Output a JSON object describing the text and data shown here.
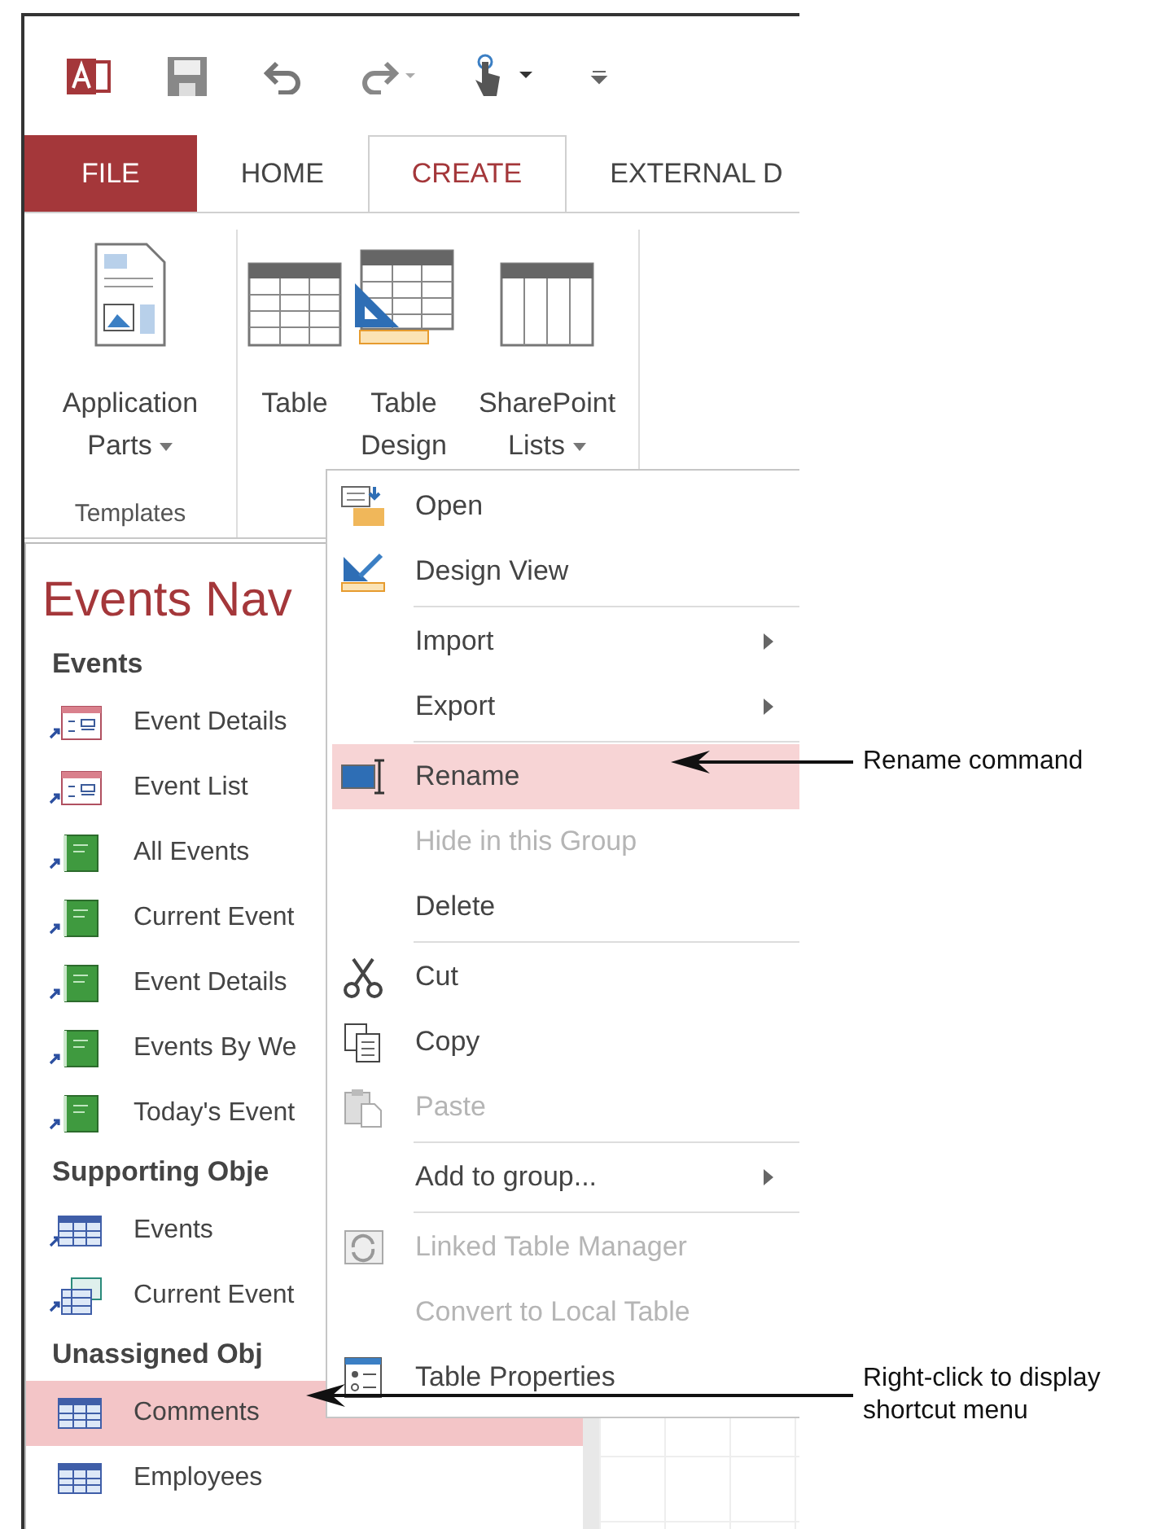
{
  "tabs": [
    {
      "label": "FILE",
      "kind": "file",
      "selected": false
    },
    {
      "label": "HOME",
      "kind": "tab",
      "selected": false
    },
    {
      "label": "CREATE",
      "kind": "tab",
      "selected": true
    },
    {
      "label": "EXTERNAL D",
      "kind": "tab",
      "selected": false
    }
  ],
  "ribbon": {
    "groups": [
      {
        "label": "Templates",
        "buttons": [
          {
            "lines": [
              "Application",
              "Parts"
            ],
            "kind": "parts",
            "dropdown": true
          }
        ]
      },
      {
        "buttons": [
          {
            "lines": [
              "Table"
            ],
            "kind": "table",
            "dropdown": false
          },
          {
            "lines": [
              "Table",
              "Design"
            ],
            "kind": "design",
            "dropdown": false
          },
          {
            "lines": [
              "SharePoint",
              "Lists"
            ],
            "kind": "sharepoint",
            "dropdown": true
          }
        ]
      }
    ]
  },
  "navigation_pane": {
    "title": "Events Nav",
    "groups": [
      {
        "label": "Events",
        "items": [
          {
            "label": "Event Details",
            "kind": "form",
            "shortcut": true,
            "selected": false
          },
          {
            "label": "Event List",
            "kind": "form",
            "shortcut": true,
            "selected": false
          },
          {
            "label": "All Events",
            "kind": "report",
            "shortcut": true,
            "selected": false
          },
          {
            "label": "Current Event",
            "kind": "report",
            "shortcut": true,
            "selected": false
          },
          {
            "label": "Event Details",
            "kind": "report",
            "shortcut": true,
            "selected": false
          },
          {
            "label": "Events By We",
            "kind": "report",
            "shortcut": true,
            "selected": false
          },
          {
            "label": "Today's Event",
            "kind": "report",
            "shortcut": true,
            "selected": false
          }
        ]
      },
      {
        "label": "Supporting Obje",
        "items": [
          {
            "label": "Events",
            "kind": "table",
            "shortcut": true,
            "selected": false
          },
          {
            "label": "Current Event",
            "kind": "query",
            "shortcut": true,
            "selected": false
          }
        ]
      },
      {
        "label": "Unassigned Obj",
        "items": [
          {
            "label": "Comments",
            "kind": "table",
            "shortcut": false,
            "selected": true
          },
          {
            "label": "Employees",
            "kind": "table",
            "shortcut": false,
            "selected": false
          }
        ]
      }
    ]
  },
  "context_menu": {
    "items": [
      {
        "kind": "open",
        "label": "Open",
        "submenu": false,
        "disabled": false,
        "selected": false
      },
      {
        "kind": "design",
        "label": "Design View",
        "submenu": false,
        "disabled": false,
        "selected": false
      },
      {
        "kind": "separator"
      },
      {
        "kind": "plain",
        "label": "Import",
        "submenu": true,
        "disabled": false,
        "selected": false
      },
      {
        "kind": "plain",
        "label": "Export",
        "submenu": true,
        "disabled": false,
        "selected": false
      },
      {
        "kind": "separator"
      },
      {
        "kind": "rename",
        "label": "Rename",
        "submenu": false,
        "disabled": false,
        "selected": true
      },
      {
        "kind": "plain",
        "label": "Hide in this Group",
        "submenu": false,
        "disabled": true,
        "selected": false
      },
      {
        "kind": "plain",
        "label": "Delete",
        "submenu": false,
        "disabled": false,
        "selected": false
      },
      {
        "kind": "separator"
      },
      {
        "kind": "cut",
        "label": "Cut",
        "submenu": false,
        "disabled": false,
        "selected": false
      },
      {
        "kind": "copy",
        "label": "Copy",
        "submenu": false,
        "disabled": false,
        "selected": false
      },
      {
        "kind": "paste",
        "label": "Paste",
        "submenu": false,
        "disabled": true,
        "selected": false
      },
      {
        "kind": "separator"
      },
      {
        "kind": "plain",
        "label": "Add to group...",
        "submenu": true,
        "disabled": false,
        "selected": false
      },
      {
        "kind": "separator"
      },
      {
        "kind": "linked",
        "label": "Linked Table Manager",
        "submenu": false,
        "disabled": true,
        "selected": false
      },
      {
        "kind": "plain",
        "label": "Convert to Local Table",
        "submenu": false,
        "disabled": true,
        "selected": false
      },
      {
        "kind": "properties",
        "label": "Table Properties",
        "submenu": false,
        "disabled": false,
        "selected": false
      }
    ]
  },
  "callouts": [
    {
      "text": "Rename command"
    },
    {
      "text": "Right-click to display shortcut menu"
    }
  ]
}
